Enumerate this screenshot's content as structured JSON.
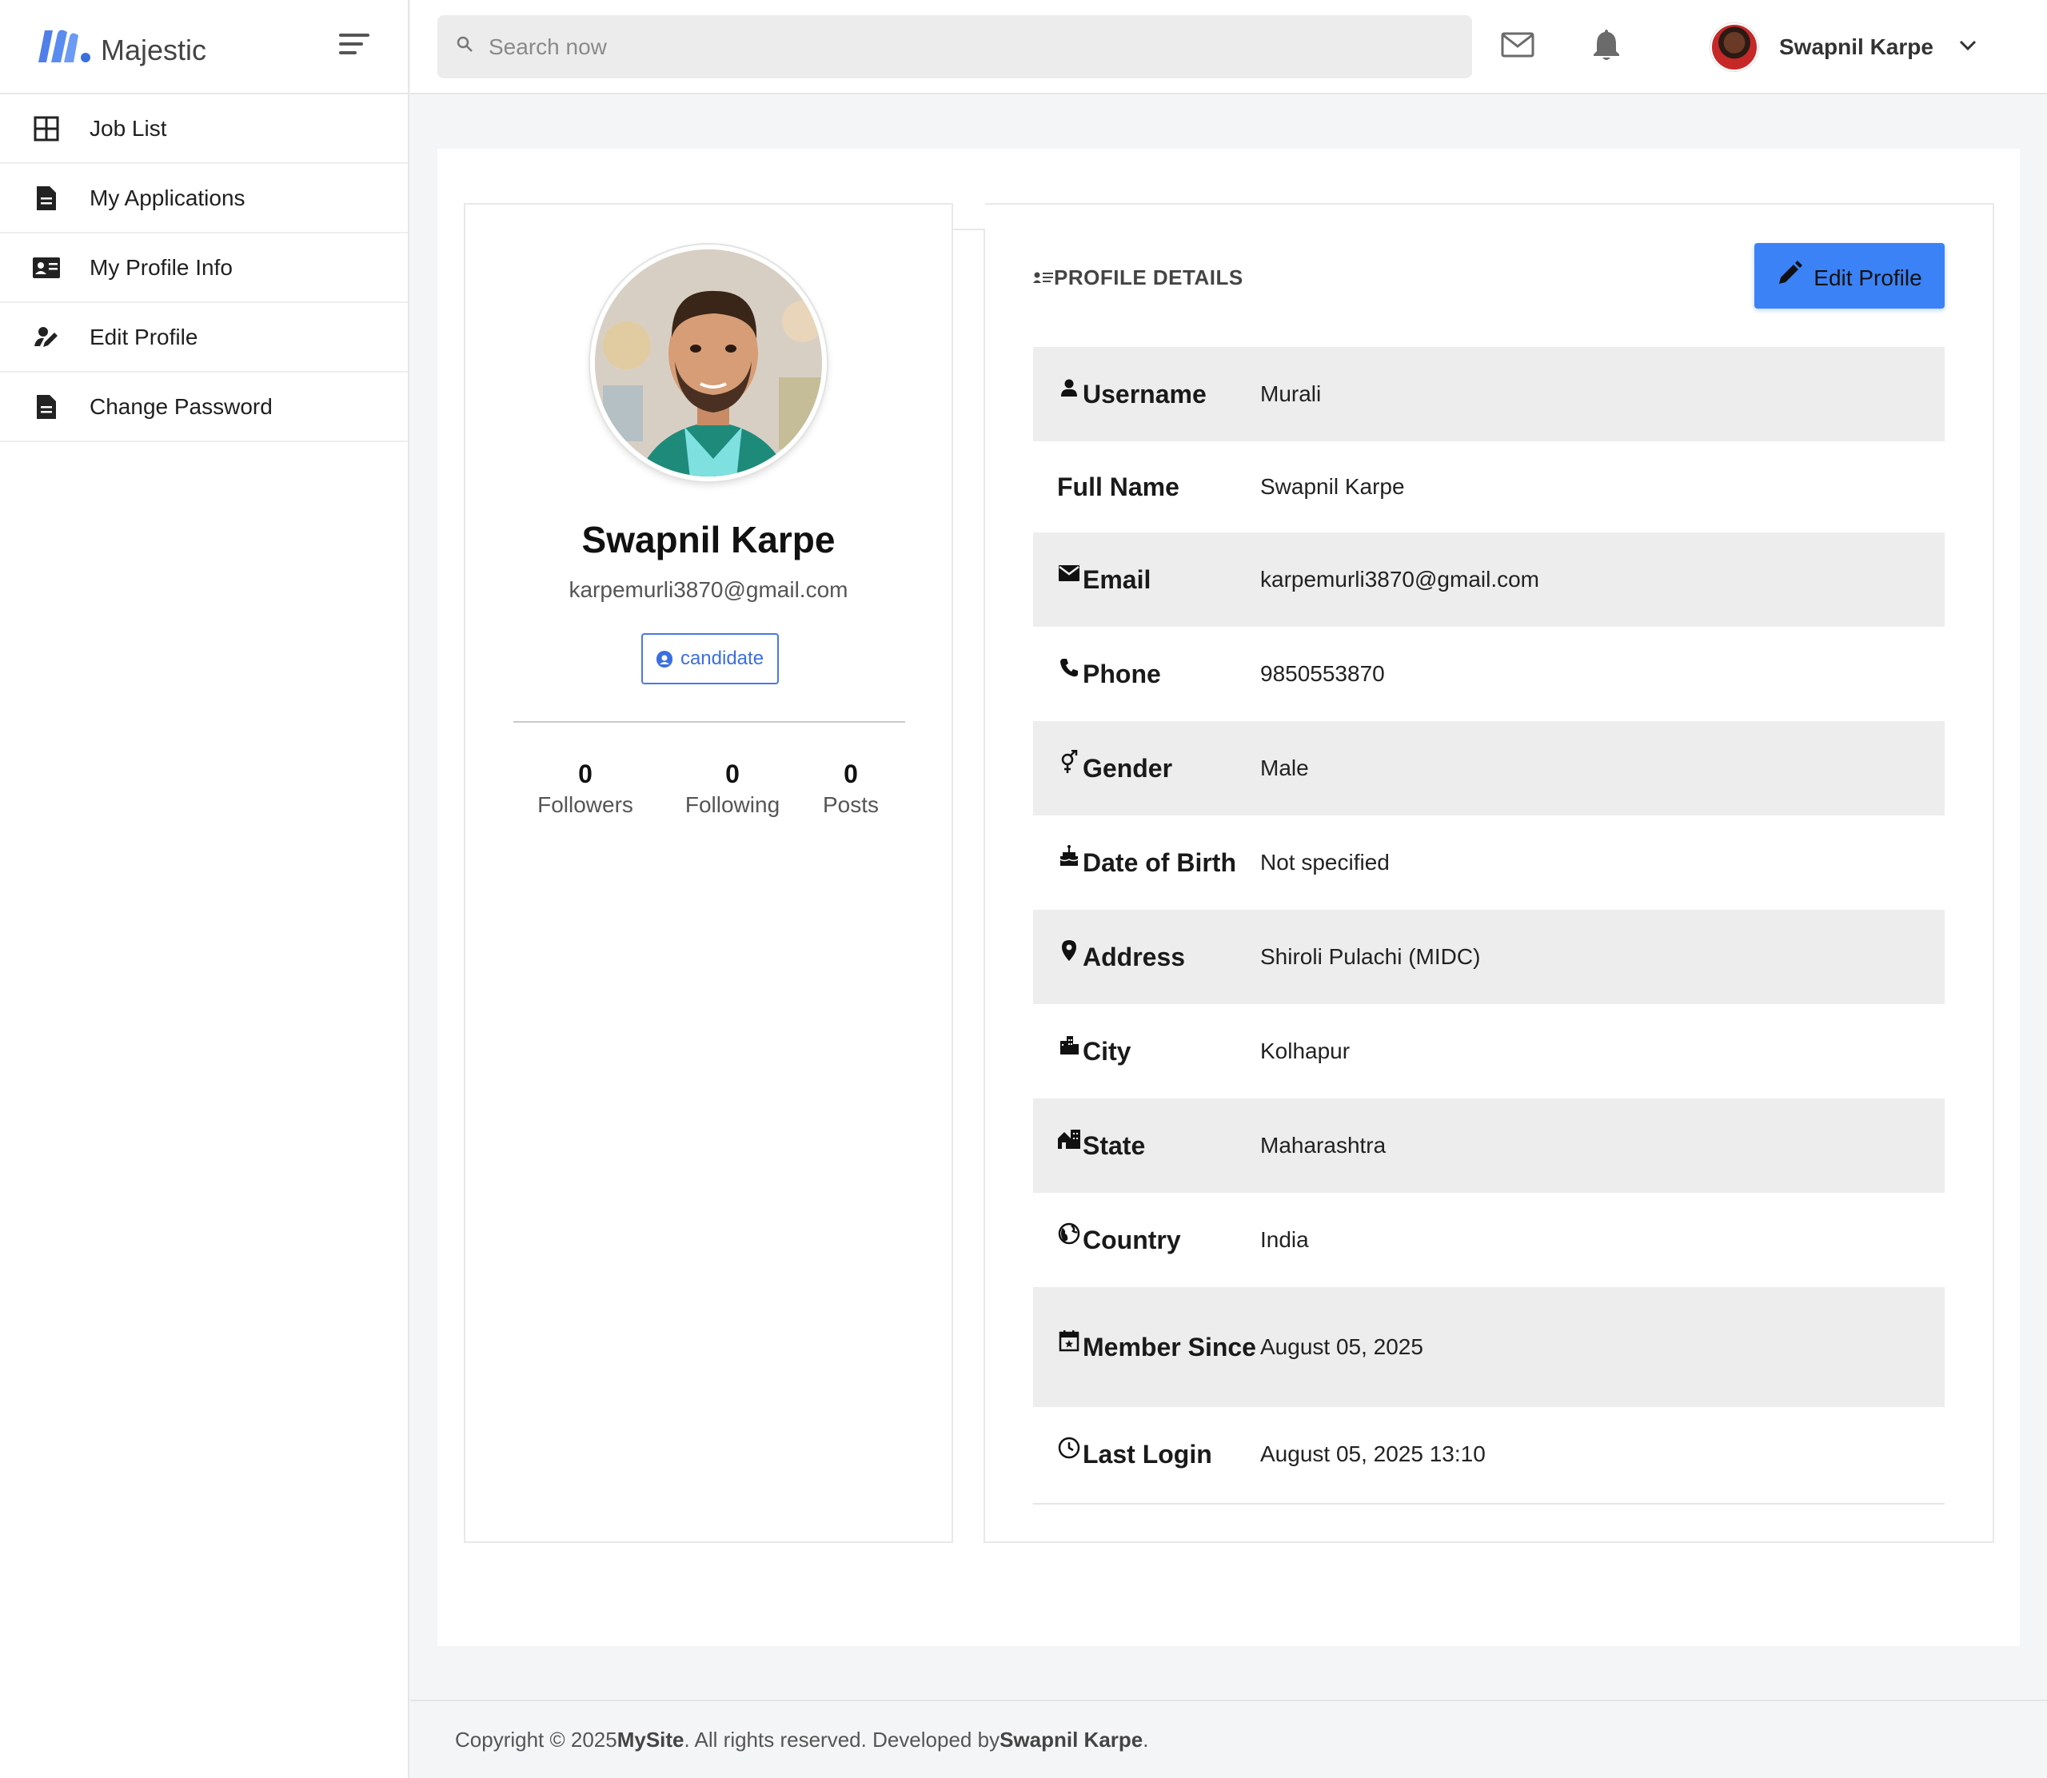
{
  "brand": {
    "name": "Majestic"
  },
  "sidebar": {
    "items": [
      {
        "label": "Job List",
        "icon": "grid-icon"
      },
      {
        "label": "My Applications",
        "icon": "document-icon"
      },
      {
        "label": "My Profile Info",
        "icon": "id-card-icon"
      },
      {
        "label": "Edit Profile",
        "icon": "user-edit-icon"
      },
      {
        "label": "Change Password",
        "icon": "document-icon"
      }
    ]
  },
  "topbar": {
    "search_placeholder": "Search now",
    "user_name": "Swapnil Karpe"
  },
  "profile_card": {
    "name": "Swapnil Karpe",
    "email": "karpemurli3870@gmail.com",
    "role": "candidate",
    "stats": [
      {
        "value": "0",
        "label": "Followers"
      },
      {
        "value": "0",
        "label": "Following"
      },
      {
        "value": "0",
        "label": "Posts"
      }
    ]
  },
  "details": {
    "title": "PROFILE DETAILS",
    "edit_button": "Edit Profile",
    "rows": [
      {
        "label": "Username",
        "value": "Murali",
        "icon": "person-icon"
      },
      {
        "label": "Full Name",
        "value": "Swapnil Karpe",
        "icon": ""
      },
      {
        "label": "Email",
        "value": "karpemurli3870@gmail.com",
        "icon": "envelope-icon"
      },
      {
        "label": "Phone",
        "value": "9850553870",
        "icon": "phone-icon"
      },
      {
        "label": "Gender",
        "value": "Male",
        "icon": "gender-icon"
      },
      {
        "label": "Date of Birth",
        "value": "Not specified",
        "icon": "cake-icon"
      },
      {
        "label": "Address",
        "value": "Shiroli Pulachi (MIDC)",
        "icon": "map-pin-icon"
      },
      {
        "label": "City",
        "value": "Kolhapur",
        "icon": "city-icon"
      },
      {
        "label": "State",
        "value": "Maharashtra",
        "icon": "house-icon"
      },
      {
        "label": "Country",
        "value": "India",
        "icon": "globe-icon"
      },
      {
        "label": "Member Since",
        "value": "August 05, 2025",
        "icon": "calendar-icon"
      },
      {
        "label": "Last Login",
        "value": "August 05, 2025 13:10",
        "icon": "clock-icon"
      }
    ]
  },
  "footer": {
    "prefix": "Copyright © 2025 ",
    "site": "MySite",
    "middle": ". All rights reserved. Developed by ",
    "author": "Swapnil Karpe",
    "suffix": "."
  },
  "colors": {
    "accent": "#3b82f6",
    "badge": "#3b6fe0",
    "row_shade": "#ededed"
  }
}
